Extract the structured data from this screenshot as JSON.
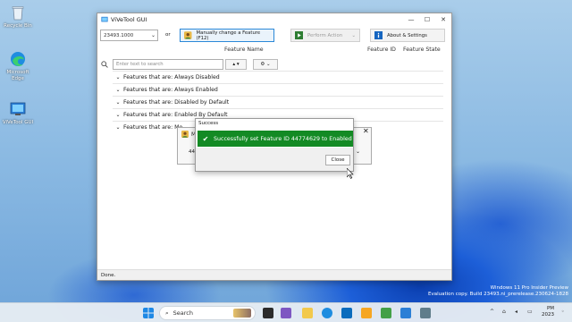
{
  "desktop": {
    "icons": [
      {
        "label": "Recycle Bin"
      },
      {
        "label": "Microsoft Edge"
      },
      {
        "label": "ViVeTool GUI"
      }
    ],
    "watermark_line1": "Windows 11 Pro Insider Preview",
    "watermark_line2": "Evaluation copy. Build 23493.ni_prerelease.230624-1828"
  },
  "main_window": {
    "title": "ViVeTool GUI",
    "build_select": "23493.1000",
    "or_text": "or",
    "manual_change_label": "Manually change a Feature (F12)",
    "perform_action_label": "Perform Action",
    "about_label": "About & Settings",
    "columns": {
      "feature_name": "Feature Name",
      "feature_id": "Feature ID",
      "feature_state": "Feature State"
    },
    "search_placeholder": "Enter text to search",
    "groups": [
      "Features that are: Always Disabled",
      "Features that are: Always Enabled",
      "Features that are: Disabled by Default",
      "Features that are: Enabled By Default",
      "Features that are: Mo"
    ],
    "status_text": "Done."
  },
  "background_dialog": {
    "label_fragment": "M",
    "field_fragment": "447"
  },
  "success_dialog": {
    "title": "Success",
    "message": "Successfully set Feature ID 44774629 to Enabled",
    "close_label": "Close"
  },
  "taskbar": {
    "search_label": "Search",
    "time": "PM",
    "date": "2023"
  },
  "colors": {
    "success_green": "#138a24",
    "accent_blue": "#2b88d8"
  }
}
